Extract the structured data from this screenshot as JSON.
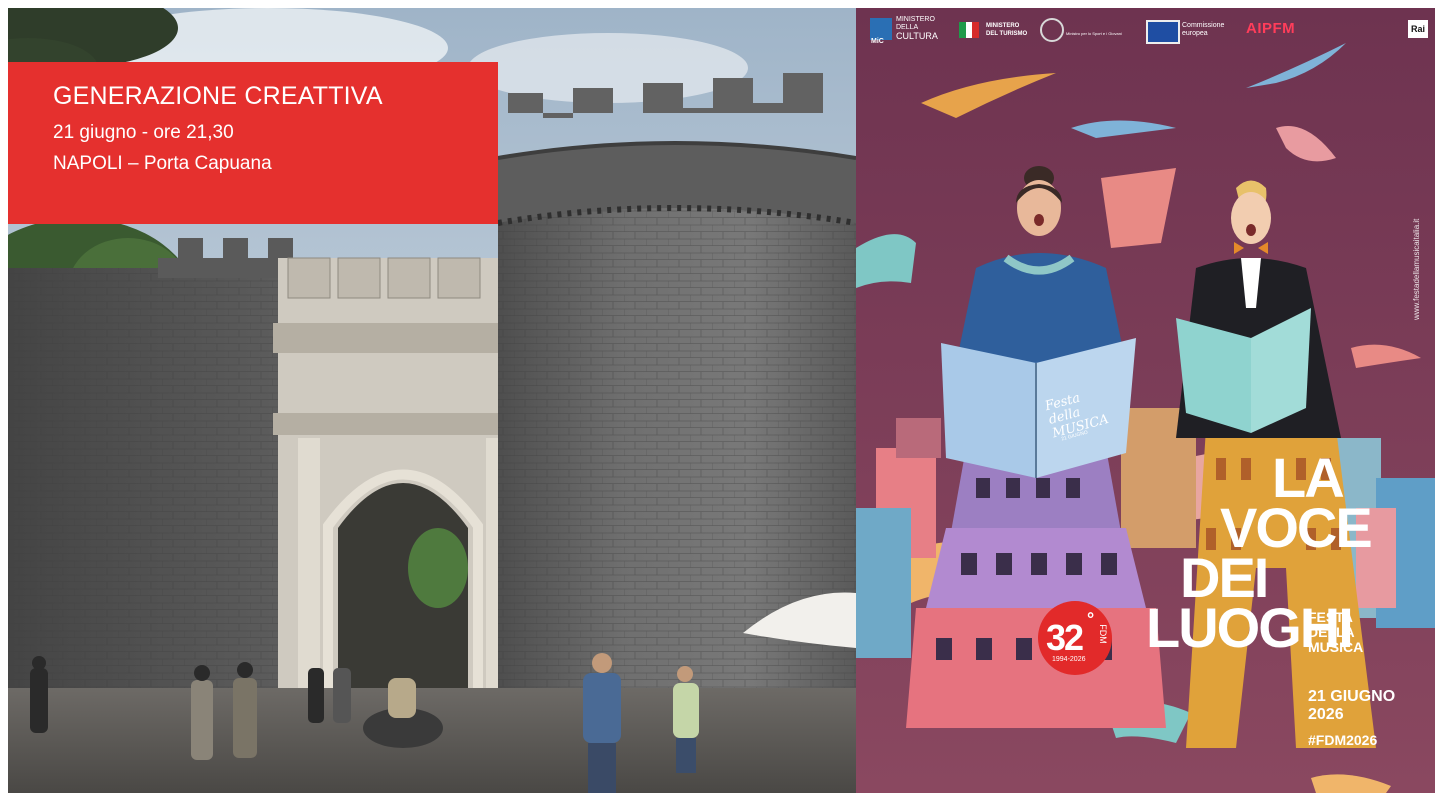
{
  "event": {
    "title": "GENERAZIONE CREATTIVA",
    "datetime": "21 giugno - ore 21,30",
    "location": "NAPOLI – Porta Capuana"
  },
  "poster": {
    "logos": {
      "mic_line1": "MINISTERO",
      "mic_line2": "DELLA",
      "mic_line3": "CULTURA",
      "mic_abbr": "MiC",
      "turismo_line1": "MINISTERO",
      "turismo_line2": "DEL TURISMO",
      "sport": "Ministro per lo Sport e i Giovani",
      "ce_line1": "Commissione",
      "ce_line2": "europea",
      "aipfm": "AIPFM",
      "rai": "Rai"
    },
    "headline": [
      "LA",
      "VOCE",
      "DEI",
      "LUOGHI"
    ],
    "festa": [
      "FESTA",
      "DELLA",
      "MUSICA"
    ],
    "date_line1": "21 GIUGNO",
    "date_line2": "2026",
    "hashtag": "#FDM2026",
    "badge_number": "32",
    "badge_sup": "°",
    "badge_fdm": "FDM",
    "badge_years": "1994-2026",
    "website": "www.festadellamusicaitalia.it",
    "book_title": "Festa della MUSICA",
    "book_sub": "21 GIUGNO"
  },
  "colors": {
    "red_banner": "#e5302e",
    "poster_bg": "#7c3a55",
    "badge_red": "#e22a2a",
    "stone": "#6b6b6b"
  }
}
